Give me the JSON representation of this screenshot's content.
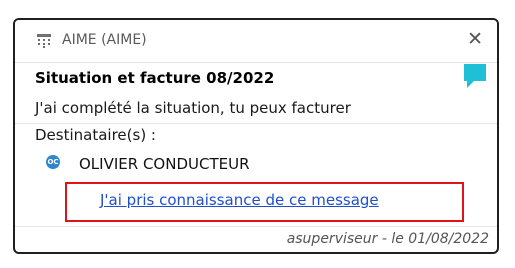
{
  "header": {
    "app_title": "AIME (AIME)",
    "app_icon": "grid-dots-icon",
    "close_icon": "close-icon",
    "close_glyph": "✕"
  },
  "message": {
    "subject": "Situation et facture 08/2022",
    "body": "J'ai complété la situation, tu peux facturer",
    "chat_icon": "chat-bubble-icon",
    "recipients_label": "Destinataire(s) :",
    "recipient": {
      "initials": "OC",
      "name": "OLIVIER CONDUCTEUR"
    },
    "acknowledge_link": "J'ai pris connaissance de ce message",
    "footer": "asuperviseur - le 01/08/2022"
  },
  "colors": {
    "accent_teal": "#1fc0d6",
    "avatar_blue": "#2f88cc",
    "link_blue": "#1f4fd0",
    "highlight_red": "#e0131c"
  }
}
